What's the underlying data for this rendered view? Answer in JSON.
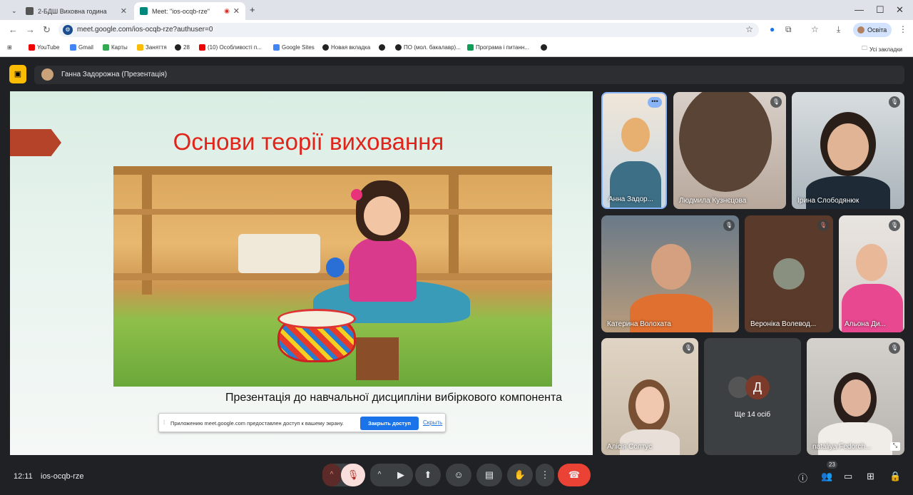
{
  "browser": {
    "tabs": [
      {
        "title": "2-БДШ Виховна година",
        "active": false
      },
      {
        "title": "Meet: \"ios-ocqb-rze\"",
        "active": true
      }
    ],
    "url": "meet.google.com/ios-ocqb-rze?authuser=0",
    "profile_label": "Освіта",
    "bookmarks": [
      "YouTube",
      "Gmail",
      "Карты",
      "Заняття",
      "28",
      "(10) Особливості п...",
      "Google Sites",
      "Новая вкладка",
      "ПО (мол. бакалавр)...",
      "Програма і питанн..."
    ],
    "all_bookmarks": "Усі закладки"
  },
  "meet": {
    "presenter_label": "Ганна Задорожна (Презентація)",
    "slide": {
      "title": "Основи теорії виховання",
      "subtitle": "Презентація до навчальної дисципліни вибіркового компонента"
    },
    "share_notice": {
      "message": "Приложению meet.google.com предоставлен доступ к вашему экрану.",
      "stop_label": "Закрыть доступ",
      "hide_label": "Скрыть"
    },
    "participants": [
      {
        "name": "Анна Задор...",
        "muted": false
      },
      {
        "name": "Людмила Кузнєцова",
        "muted": true
      },
      {
        "name": "Ірина Слободянюк",
        "muted": true
      },
      {
        "name": "Катерина Волохата",
        "muted": true
      },
      {
        "name": "Вероніка Волевод...",
        "muted": true
      },
      {
        "name": "Альона Ди...",
        "muted": true
      },
      {
        "name": "Алісія Солтус",
        "muted": true
      },
      {
        "name": "nataliya Fedorch...",
        "muted": true
      }
    ],
    "others_label": "Ще 14 осіб",
    "others_initial": "Д",
    "time": "12:11",
    "meeting_code": "ios-ocqb-rze",
    "participant_count": "23",
    "colors": {
      "accent": "#8ab4f8",
      "end_call": "#ea4335",
      "present_icon": "#fbbc04"
    }
  }
}
